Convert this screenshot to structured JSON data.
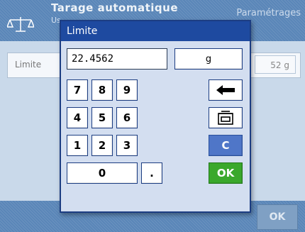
{
  "background": {
    "title": "Tarage automatique",
    "subtitle": "Us",
    "right_title": "Paramétrages",
    "row_label": "Limite",
    "row_value": "52 g",
    "ok_label": "OK"
  },
  "dialog": {
    "title": "Limite",
    "input_value": "22.4562",
    "unit_label": "g",
    "keys": {
      "k7": "7",
      "k8": "8",
      "k9": "9",
      "k4": "4",
      "k5": "5",
      "k6": "6",
      "k1": "1",
      "k2": "2",
      "k3": "3",
      "k0": "0",
      "dot": ".",
      "clear": "C",
      "ok": "OK"
    }
  },
  "colors": {
    "title_bar": "#1e4aa0",
    "dialog_bg": "#d3def0",
    "ok_green": "#3aa82c",
    "clear_blue": "#4f76c8"
  },
  "icons": [
    "scale-logo-icon",
    "backspace-arrow-icon",
    "tare-weight-icon"
  ]
}
